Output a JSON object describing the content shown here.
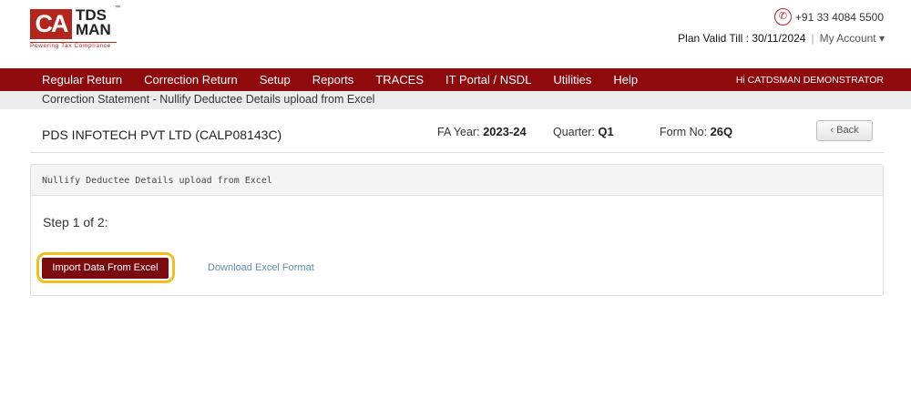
{
  "logo": {
    "mark": "CA",
    "name_line1": "TDS",
    "name_line2": "MAN",
    "tm": "™",
    "tagline": "Powering Tax Compliance"
  },
  "header": {
    "phone": "+91 33 4084 5500",
    "plan_label": "Plan Valid Till : 30/11/2024",
    "separator": "|",
    "my_account": "My Account ▾"
  },
  "nav": {
    "items": [
      "Regular Return",
      "Correction Return",
      "Setup",
      "Reports",
      "TRACES",
      "IT Portal / NSDL",
      "Utilities",
      "Help"
    ],
    "greeting": "Hi CATDSMAN DEMONSTRATOR"
  },
  "breadcrumb": "Correction Statement - Nullify Deductee Details upload from Excel",
  "info": {
    "company": "PDS INFOTECH PVT LTD (CALP08143C)",
    "fa_label": "FA Year:",
    "fa_value": "2023-24",
    "quarter_label": "Quarter:",
    "quarter_value": "Q1",
    "form_label": "Form No:",
    "form_value": "26Q",
    "back": "Back"
  },
  "panel": {
    "title": "Nullify Deductee Details upload from Excel",
    "step": "Step 1 of 2:",
    "import_button": "Import Data From Excel",
    "download_link": "Download Excel Format"
  },
  "colors": {
    "brand": "#8e0a0d",
    "highlight": "#f2be1f"
  }
}
